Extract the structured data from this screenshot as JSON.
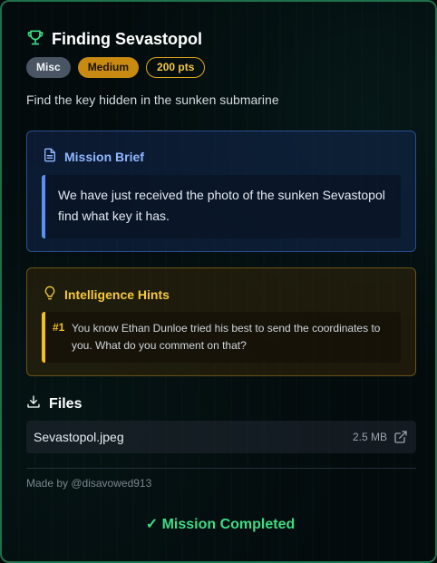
{
  "challenge": {
    "title": "Finding Sevastopol",
    "category": "Misc",
    "difficulty": "Medium",
    "points": "200 pts",
    "description": "Find the key hidden in the sunken submarine"
  },
  "brief": {
    "heading": "Mission Brief",
    "text": "We have just received the photo of the sunken Sevastopol find what key it has."
  },
  "hints": {
    "heading": "Intelligence Hints",
    "items": [
      {
        "number": "#1",
        "text": "You know Ethan Dunloe tried his best to send the coordinates to you. What do you comment on that?"
      }
    ]
  },
  "files": {
    "heading": "Files",
    "items": [
      {
        "name": "Sevastopol.jpeg",
        "size": "2.5 MB"
      }
    ]
  },
  "author": "Made by @disavowed913",
  "status": "✓ Mission Completed",
  "icons": {
    "title": "trophy-icon",
    "brief": "document-icon",
    "hints": "lightbulb-icon",
    "files": "download-icon",
    "file_open": "external-link-icon"
  },
  "colors": {
    "accent_green": "#3ddc84",
    "brief_blue": "#8fb6ff",
    "hint_gold": "#f5c842",
    "difficulty_badge": "#c98a12",
    "category_badge": "#4a5563"
  }
}
